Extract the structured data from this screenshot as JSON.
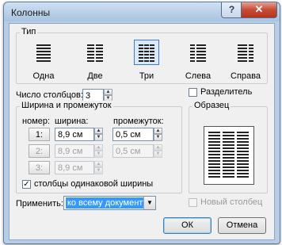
{
  "dialog": {
    "title": "Колонны",
    "help_label": "?",
    "close_label": "✕"
  },
  "type_group": {
    "label": "Тип",
    "presets": [
      {
        "label": "Одна",
        "selected": false
      },
      {
        "label": "Две",
        "selected": false
      },
      {
        "label": "Три",
        "selected": true
      },
      {
        "label": "Слева",
        "selected": false
      },
      {
        "label": "Справа",
        "selected": false
      }
    ]
  },
  "num_columns": {
    "label": "Число столбцов:",
    "value": "3"
  },
  "separator": {
    "label": "Разделитель",
    "checked": false
  },
  "width_group": {
    "label": "Ширина и промежуток",
    "col_number_header": "номер:",
    "width_header": "ширина:",
    "spacing_header": "промежуток:",
    "rows": [
      {
        "number": "1:",
        "width": "8,9 см",
        "spacing": "0,5 см",
        "enabled": true
      },
      {
        "number": "2:",
        "width": "8,9 см",
        "spacing": "0,5 см",
        "enabled": false
      },
      {
        "number": "3:",
        "width": "8,9 см",
        "spacing": "",
        "enabled": false
      }
    ],
    "equal_width": {
      "label": "столбцы одинаковой ширины",
      "checked": true
    }
  },
  "preview_group": {
    "label": "Образец"
  },
  "apply": {
    "label": "Применить:",
    "value": "ко всему документу"
  },
  "new_column": {
    "label": "Новый столбец",
    "checked": false
  },
  "buttons": {
    "ok_label": "ОК",
    "cancel_label": "Отмена"
  },
  "colors": {
    "selection": "#3399ff",
    "accent_border": "#3d7bd0",
    "close_button": "#c64b35"
  }
}
